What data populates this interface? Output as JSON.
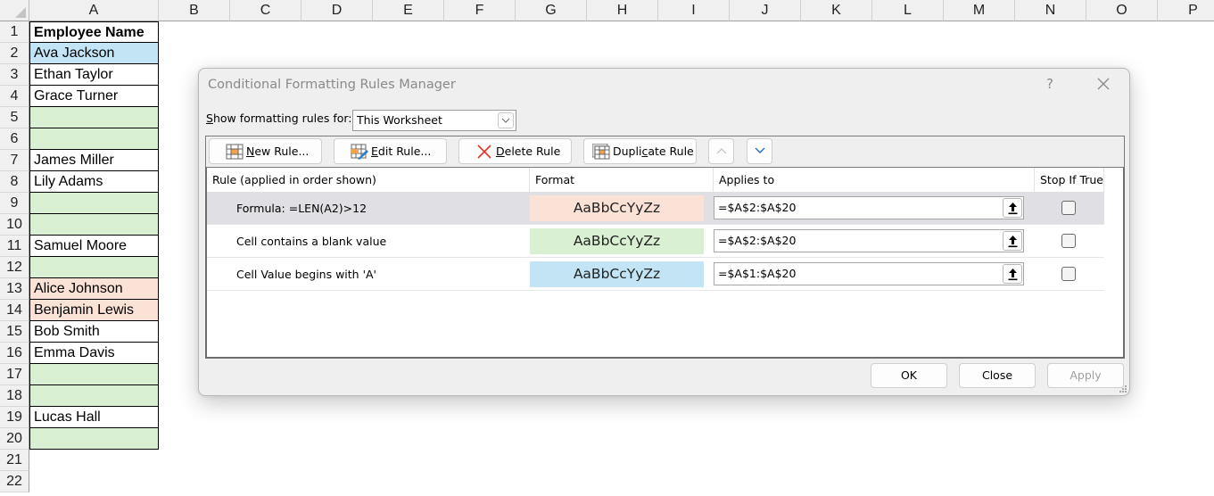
{
  "spreadsheet": {
    "columns": [
      "A",
      "B",
      "C",
      "D",
      "E",
      "F",
      "G",
      "H",
      "I",
      "J",
      "K",
      "L",
      "M",
      "N",
      "O",
      "P"
    ],
    "rows": [
      "1",
      "2",
      "3",
      "4",
      "5",
      "6",
      "7",
      "8",
      "9",
      "10",
      "11",
      "12",
      "13",
      "14",
      "15",
      "16",
      "17",
      "18",
      "19",
      "20",
      "21",
      "22"
    ],
    "cells": [
      {
        "row": "1",
        "value": "Employee Name",
        "fill": "white",
        "bold": true
      },
      {
        "row": "2",
        "value": "Ava Jackson",
        "fill": "blue"
      },
      {
        "row": "3",
        "value": "Ethan Taylor",
        "fill": "white"
      },
      {
        "row": "4",
        "value": "Grace Turner",
        "fill": "white"
      },
      {
        "row": "5",
        "value": "",
        "fill": "green"
      },
      {
        "row": "6",
        "value": "",
        "fill": "green"
      },
      {
        "row": "7",
        "value": "James Miller",
        "fill": "white"
      },
      {
        "row": "8",
        "value": "Lily Adams",
        "fill": "white"
      },
      {
        "row": "9",
        "value": "",
        "fill": "green"
      },
      {
        "row": "10",
        "value": "",
        "fill": "green"
      },
      {
        "row": "11",
        "value": "Samuel Moore",
        "fill": "white"
      },
      {
        "row": "12",
        "value": "",
        "fill": "green"
      },
      {
        "row": "13",
        "value": "Alice Johnson",
        "fill": "peach"
      },
      {
        "row": "14",
        "value": "Benjamin Lewis",
        "fill": "peach"
      },
      {
        "row": "15",
        "value": "Bob Smith",
        "fill": "white"
      },
      {
        "row": "16",
        "value": "Emma Davis",
        "fill": "white"
      },
      {
        "row": "17",
        "value": "",
        "fill": "green"
      },
      {
        "row": "18",
        "value": "",
        "fill": "green"
      },
      {
        "row": "19",
        "value": "Lucas Hall",
        "fill": "white"
      },
      {
        "row": "20",
        "value": "",
        "fill": "green"
      }
    ]
  },
  "colors": {
    "blue_fill": "#c2e4f5",
    "green_fill": "#d9f0d2",
    "peach_fill": "#fbe2d6",
    "selected_row": "#e0e0e4"
  },
  "dialog": {
    "title": "Conditional Formatting Rules Manager",
    "help_label": "?",
    "show_rules_label_accel": "S",
    "show_rules_label_rest": "how formatting rules for:",
    "scope_value": "This Worksheet",
    "toolbar": {
      "new_rule": {
        "accel": "N",
        "rest": "ew Rule..."
      },
      "edit_rule": {
        "accel": "E",
        "rest": "dit Rule..."
      },
      "delete_rule": {
        "accel": "D",
        "rest": "elete Rule"
      },
      "duplicate_rule": {
        "pre": "Dupli",
        "accel": "c",
        "rest": "ate Rule"
      }
    },
    "columns": {
      "rule": "Rule (applied in order shown)",
      "format": "Format",
      "applies_to": "Applies to",
      "stop_if_true": "Stop If True"
    },
    "rules": [
      {
        "rule": "Formula: =LEN(A2)>12",
        "preview": "AaBbCcYyZz",
        "preview_color": "#fbe2d6",
        "applies_to": "=$A$2:$A$20",
        "stop_if_true": false,
        "selected": true
      },
      {
        "rule": "Cell contains a blank value",
        "preview": "AaBbCcYyZz",
        "preview_color": "#d9f0d2",
        "applies_to": "=$A$2:$A$20",
        "stop_if_true": false,
        "selected": false
      },
      {
        "rule": "Cell Value begins with 'A'",
        "preview": "AaBbCcYyZz",
        "preview_color": "#c2e4f5",
        "applies_to": "=$A$1:$A$20",
        "stop_if_true": false,
        "selected": false
      }
    ],
    "buttons": {
      "ok": "OK",
      "close": "Close",
      "apply": "Apply"
    }
  }
}
